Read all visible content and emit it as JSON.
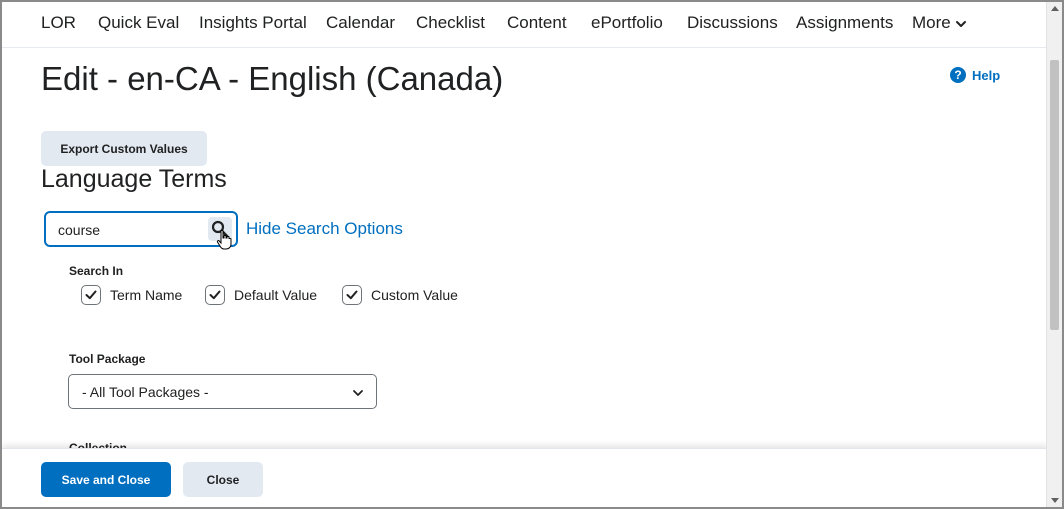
{
  "nav": {
    "items": [
      "LOR",
      "Quick Eval",
      "Insights Portal",
      "Calendar",
      "Checklist",
      "Content",
      "ePortfolio",
      "Discussions",
      "Assignments",
      "More"
    ]
  },
  "page": {
    "title": "Edit - en-CA - English (Canada)",
    "help_label": "Help",
    "export_label": "Export Custom Values",
    "section_title": "Language Terms"
  },
  "search": {
    "value": "course",
    "hide_options_label": "Hide Search Options",
    "search_in_label": "Search In",
    "checkboxes": [
      {
        "label": "Term Name",
        "checked": true
      },
      {
        "label": "Default Value",
        "checked": true
      },
      {
        "label": "Custom Value",
        "checked": true
      }
    ]
  },
  "tool_package": {
    "label": "Tool Package",
    "selected": "- All Tool Packages -"
  },
  "collection": {
    "label": "Collection"
  },
  "footer": {
    "save_label": "Save and Close",
    "close_label": "Close"
  },
  "colors": {
    "accent": "#006fbf",
    "secondary_button": "#e3e9f1",
    "text": "#202122"
  }
}
